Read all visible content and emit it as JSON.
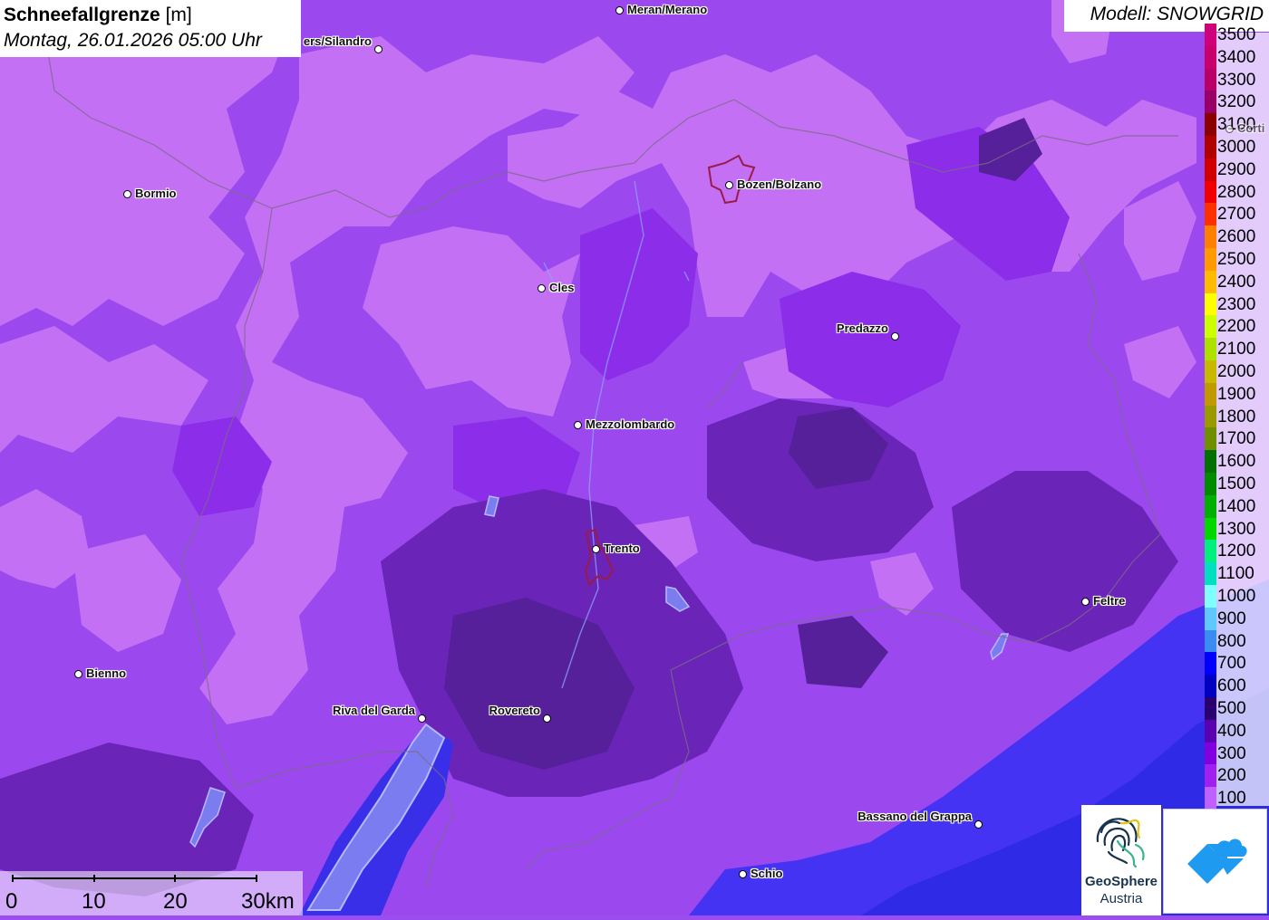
{
  "header": {
    "title": "Schneefallgrenze",
    "unit": "[m]",
    "datetime": "Montag, 26.01.2026 05:00 Uhr",
    "model": "Modell: SNOWGRID"
  },
  "legend": {
    "items": [
      {
        "label": "3500",
        "color": "#d0007a"
      },
      {
        "label": "3400",
        "color": "#c8006e"
      },
      {
        "label": "3300",
        "color": "#b80066"
      },
      {
        "label": "3200",
        "color": "#990066"
      },
      {
        "label": "3100",
        "color": "#8b0000"
      },
      {
        "label": "3000",
        "color": "#b00000"
      },
      {
        "label": "2900",
        "color": "#d00000"
      },
      {
        "label": "2800",
        "color": "#f00000"
      },
      {
        "label": "2700",
        "color": "#ff3000"
      },
      {
        "label": "2600",
        "color": "#ff8000"
      },
      {
        "label": "2500",
        "color": "#ff9a00"
      },
      {
        "label": "2400",
        "color": "#ffbb00"
      },
      {
        "label": "2300",
        "color": "#ffff00"
      },
      {
        "label": "2200",
        "color": "#ccff00"
      },
      {
        "label": "2100",
        "color": "#aee000"
      },
      {
        "label": "2000",
        "color": "#c8b800"
      },
      {
        "label": "1900",
        "color": "#c09a00"
      },
      {
        "label": "1800",
        "color": "#9a9a00"
      },
      {
        "label": "1700",
        "color": "#6f8f00"
      },
      {
        "label": "1600",
        "color": "#007000"
      },
      {
        "label": "1500",
        "color": "#008a00"
      },
      {
        "label": "1400",
        "color": "#00b000"
      },
      {
        "label": "1300",
        "color": "#00d800"
      },
      {
        "label": "1200",
        "color": "#00f080"
      },
      {
        "label": "1100",
        "color": "#00e0c0"
      },
      {
        "label": "1000",
        "color": "#80ffff"
      },
      {
        "label": "900",
        "color": "#60c8ff"
      },
      {
        "label": "800",
        "color": "#3a8cf0"
      },
      {
        "label": "700",
        "color": "#0000ff"
      },
      {
        "label": "600",
        "color": "#0000c0"
      },
      {
        "label": "500",
        "color": "#2a0070"
      },
      {
        "label": "400",
        "color": "#5a00b0"
      },
      {
        "label": "300",
        "color": "#8000e0"
      },
      {
        "label": "200",
        "color": "#a020f0"
      },
      {
        "label": "100",
        "color": "#c060ff"
      }
    ]
  },
  "cities": [
    {
      "name": "Meran/Merano",
      "label_side": "right"
    },
    {
      "name": "ers/Silandro",
      "label_side": "left"
    },
    {
      "name": "Bormio",
      "label_side": "right"
    },
    {
      "name": "Bozen/Bolzano",
      "label_side": "right"
    },
    {
      "name": "Cles",
      "label_side": "right"
    },
    {
      "name": "Predazzo",
      "label_side": "left"
    },
    {
      "name": "Mezzolombardo",
      "label_side": "right"
    },
    {
      "name": "Trento",
      "label_side": "right"
    },
    {
      "name": "Feltre",
      "label_side": "right"
    },
    {
      "name": "Bienno",
      "label_side": "right"
    },
    {
      "name": "Riva del Garda",
      "label_side": "left"
    },
    {
      "name": "Rovereto",
      "label_side": "left"
    },
    {
      "name": "Bassano del Grappa",
      "label_side": "left"
    },
    {
      "name": "Schio",
      "label_side": "right"
    },
    {
      "name": "Corti",
      "label_side": "right"
    }
  ],
  "scale_bar": {
    "labels": [
      "0",
      "10",
      "20",
      "30km"
    ]
  },
  "logos": {
    "geosphere_name": "GeoSphere",
    "geosphere_sub": "Austria",
    "app_icon": "cloud-diamond-icon"
  },
  "map_colors": {
    "light": "#c470f4",
    "mid": "#a43ef0",
    "violet": "#8a2be8",
    "purple": "#7426d8",
    "dark": "#5a23a0",
    "blue": "#3f33ff",
    "deepblue": "#2c28e8"
  }
}
